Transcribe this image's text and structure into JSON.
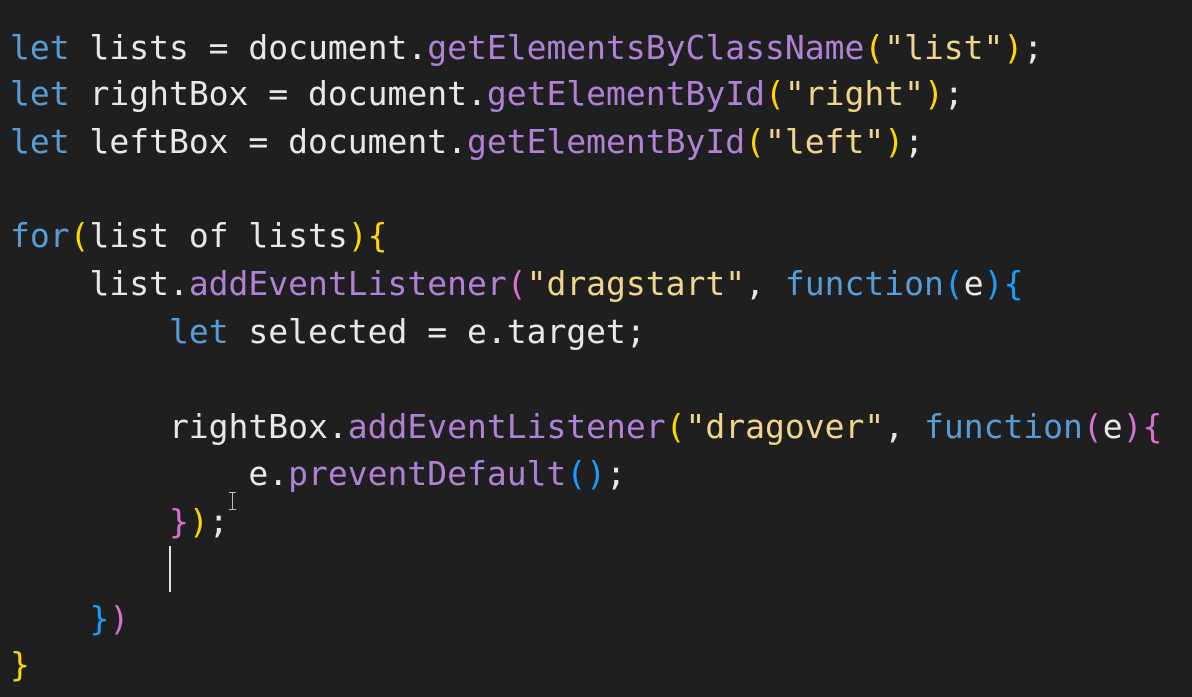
{
  "lines": [
    {
      "tokens": [
        {
          "t": "let",
          "c": "kw"
        },
        {
          "t": " lists = document.",
          "c": "id"
        },
        {
          "t": "getElementsByClassName",
          "c": "meth"
        },
        {
          "t": "(",
          "c": "brY"
        },
        {
          "t": "\"list\"",
          "c": "strY"
        },
        {
          "t": ")",
          "c": "brY"
        },
        {
          "t": ";",
          "c": "id"
        }
      ]
    },
    {
      "tokens": [
        {
          "t": "let",
          "c": "kw"
        },
        {
          "t": " rightBox = document.",
          "c": "id"
        },
        {
          "t": "getElementById",
          "c": "meth"
        },
        {
          "t": "(",
          "c": "brY"
        },
        {
          "t": "\"right\"",
          "c": "strY"
        },
        {
          "t": ")",
          "c": "brY"
        },
        {
          "t": ";",
          "c": "id"
        }
      ]
    },
    {
      "tokens": [
        {
          "t": "let",
          "c": "kw"
        },
        {
          "t": " leftBox = document.",
          "c": "id"
        },
        {
          "t": "getElementById",
          "c": "meth"
        },
        {
          "t": "(",
          "c": "brY"
        },
        {
          "t": "\"left\"",
          "c": "strY"
        },
        {
          "t": ")",
          "c": "brY"
        },
        {
          "t": ";",
          "c": "id"
        }
      ]
    },
    {
      "tokens": []
    },
    {
      "tokens": [
        {
          "t": "for",
          "c": "kw"
        },
        {
          "t": "(",
          "c": "brY"
        },
        {
          "t": "list of lists",
          "c": "id"
        },
        {
          "t": ")",
          "c": "brY"
        },
        {
          "t": "{",
          "c": "brY"
        }
      ]
    },
    {
      "tokens": [
        {
          "t": "    list.",
          "c": "id"
        },
        {
          "t": "addEventListener",
          "c": "meth"
        },
        {
          "t": "(",
          "c": "brP"
        },
        {
          "t": "\"dragstart\"",
          "c": "strY"
        },
        {
          "t": ", ",
          "c": "id"
        },
        {
          "t": "function",
          "c": "kw"
        },
        {
          "t": "(",
          "c": "brB"
        },
        {
          "t": "e",
          "c": "id"
        },
        {
          "t": ")",
          "c": "brB"
        },
        {
          "t": "{",
          "c": "brB"
        }
      ]
    },
    {
      "tokens": [
        {
          "t": "        ",
          "c": "id"
        },
        {
          "t": "let",
          "c": "kw"
        },
        {
          "t": " selected = e.target;",
          "c": "id"
        }
      ]
    },
    {
      "tokens": []
    },
    {
      "tokens": [
        {
          "t": "        rightBox.",
          "c": "id"
        },
        {
          "t": "addEventListener",
          "c": "meth"
        },
        {
          "t": "(",
          "c": "brY"
        },
        {
          "t": "\"dragover\"",
          "c": "strY"
        },
        {
          "t": ", ",
          "c": "id"
        },
        {
          "t": "function",
          "c": "kw"
        },
        {
          "t": "(",
          "c": "brP"
        },
        {
          "t": "e",
          "c": "id"
        },
        {
          "t": ")",
          "c": "brP"
        },
        {
          "t": "{",
          "c": "brP"
        }
      ]
    },
    {
      "tokens": [
        {
          "t": "            e.",
          "c": "id"
        },
        {
          "t": "preventDefault",
          "c": "meth"
        },
        {
          "t": "()",
          "c": "brB"
        },
        {
          "t": ";",
          "c": "id"
        }
      ]
    },
    {
      "tokens": [
        {
          "t": "        ",
          "c": "id"
        },
        {
          "t": "}",
          "c": "brP"
        },
        {
          "t": ")",
          "c": "brY"
        },
        {
          "t": ";",
          "c": "id"
        }
      ]
    },
    {
      "tokens": []
    },
    {
      "tokens": [
        {
          "t": "    ",
          "c": "id"
        },
        {
          "t": "}",
          "c": "brB"
        },
        {
          "t": ")",
          "c": "brP"
        }
      ]
    },
    {
      "tokens": [
        {
          "t": "}",
          "c": "brY"
        }
      ]
    }
  ]
}
